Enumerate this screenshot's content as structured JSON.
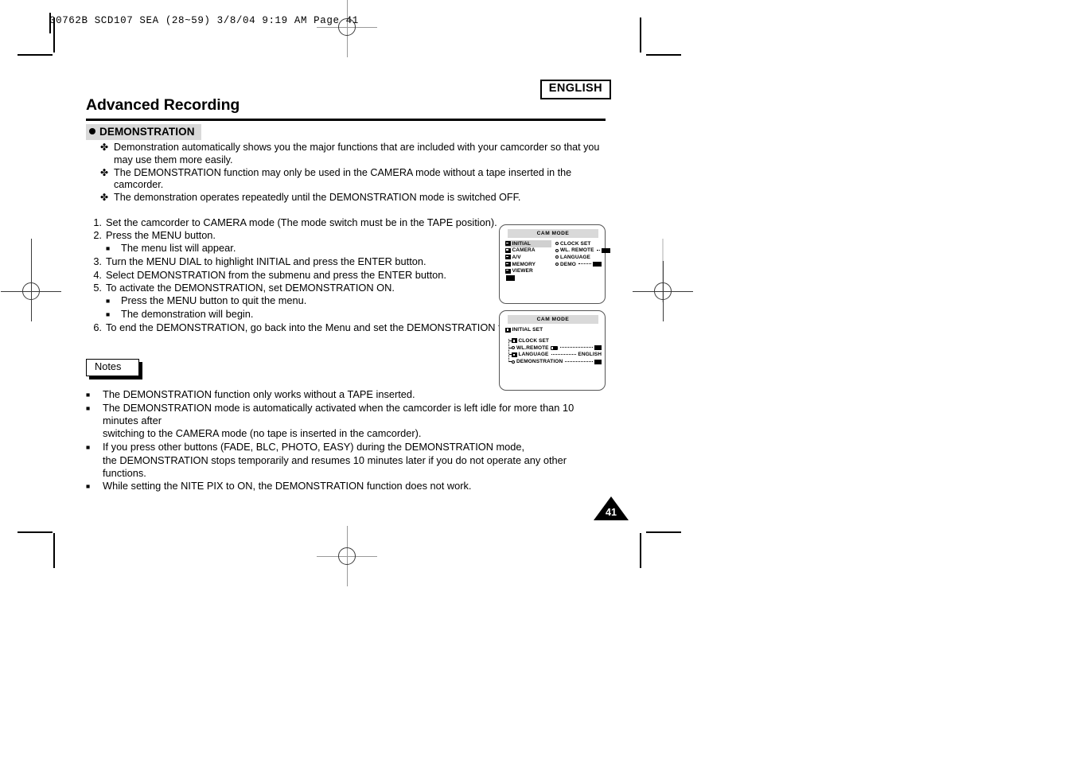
{
  "slug": "00762B SCD107 SEA (28~59)   3/8/04 9:19 AM   Page 41",
  "header": {
    "language_badge": "ENGLISH",
    "title": "Advanced Recording",
    "section_bullet": "●",
    "section_title": "DEMONSTRATION"
  },
  "intro": {
    "bullet_glyph": "✤",
    "items": [
      "Demonstration automatically shows you the major functions that are included with your camcorder so that you may use them more easily.",
      "The DEMONSTRATION function may only be used in the CAMERA mode without a tape inserted in the camcorder.",
      "The demonstration operates repeatedly until the DEMONSTRATION mode is switched OFF."
    ]
  },
  "steps": {
    "sub_glyph": "■",
    "items": [
      {
        "num": "1.",
        "text": "Set the camcorder to CAMERA mode (The mode switch must be in the TAPE position)."
      },
      {
        "num": "2.",
        "text": "Press the MENU button.",
        "subs": [
          "The menu list will appear."
        ]
      },
      {
        "num": "3.",
        "text": "Turn the MENU DIAL to highlight INITIAL and press the ENTER button."
      },
      {
        "num": "4.",
        "text": "Select DEMONSTRATION from the submenu and press the ENTER button."
      },
      {
        "num": "5.",
        "text": "To activate the DEMONSTRATION, set DEMONSTRATION ON.",
        "subs": [
          "Press the MENU button to quit the menu.",
          "The demonstration will begin."
        ]
      },
      {
        "num": "6.",
        "text": "To end the DEMONSTRATION, go back into the Menu and set the DEMONSTRATION to OFF."
      }
    ]
  },
  "notes": {
    "box_label": "Notes",
    "bullet_glyph": "■",
    "items": [
      {
        "text": "The DEMONSTRATION function only works without a TAPE inserted."
      },
      {
        "text": "The DEMONSTRATION mode is automatically activated when the camcorder is left idle for more than 10 minutes after",
        "cont": "switching to the CAMERA mode (no tape is inserted in the camcorder)."
      },
      {
        "text": "If you press other buttons (FADE, BLC, PHOTO, EASY) during the DEMONSTRATION mode,",
        "cont": "the DEMONSTRATION stops temporarily and resumes 10 minutes later if you do not operate any other functions."
      },
      {
        "text": "While setting the NITE PIX to ON, the DEMONSTRATION function does not work."
      }
    ]
  },
  "lcd1": {
    "title": "CAM MODE",
    "left_items": [
      {
        "label": "INITIAL",
        "highlighted": true
      },
      {
        "label": "CAMERA",
        "highlighted": false
      },
      {
        "label": "A/V",
        "highlighted": false
      },
      {
        "label": "MEMORY",
        "highlighted": false
      },
      {
        "label": "VIEWER",
        "highlighted": false
      }
    ],
    "right_items": [
      {
        "label": "CLOCK  SET",
        "value": ""
      },
      {
        "label": "WL. REMOTE",
        "value": "block"
      },
      {
        "label": "LANGUAGE",
        "value": ""
      },
      {
        "label": "DEMO",
        "value": "block"
      }
    ]
  },
  "lcd2": {
    "title": "CAM  MODE",
    "header": "INITIAL SET",
    "items": [
      {
        "label": "CLOCK  SET",
        "value": ""
      },
      {
        "label": "WL.REMOTE",
        "value": "block"
      },
      {
        "label": "LANGUAGE",
        "value": "ENGLISH"
      },
      {
        "label": "DEMONSTRATION",
        "value": "block"
      }
    ]
  },
  "page_number": "41"
}
